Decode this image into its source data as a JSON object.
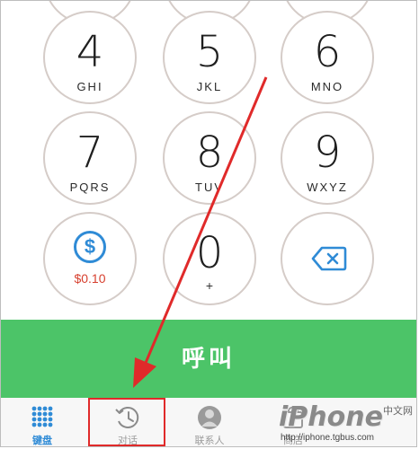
{
  "keypad": {
    "keys": [
      {
        "digit": "4",
        "letters": "GHI"
      },
      {
        "digit": "5",
        "letters": "JKL"
      },
      {
        "digit": "6",
        "letters": "MNO"
      },
      {
        "digit": "7",
        "letters": "PQRS"
      },
      {
        "digit": "8",
        "letters": "TUV"
      },
      {
        "digit": "9",
        "letters": "WXYZ"
      },
      {
        "digit": "0",
        "letters": "+"
      }
    ],
    "credit": {
      "symbol": "$",
      "amount": "$0.10"
    }
  },
  "call_button": {
    "label": "呼叫"
  },
  "tabbar": {
    "tabs": [
      {
        "label": "键盘",
        "icon": "keypad-grid-icon",
        "active": true
      },
      {
        "label": "对话",
        "icon": "history-clock-icon",
        "active": false
      },
      {
        "label": "联系人",
        "icon": "contact-person-icon",
        "active": false
      },
      {
        "label": "商店",
        "icon": "store-icon",
        "active": false
      }
    ]
  },
  "watermark": {
    "brand": "iPhone",
    "subtitle": "中文网",
    "url": "http://iphone.tgbus.com"
  },
  "colors": {
    "call_green": "#4cc468",
    "accent_blue": "#2f8bd6",
    "price_red": "#d7402f",
    "annotation_red": "#e02a2a"
  }
}
